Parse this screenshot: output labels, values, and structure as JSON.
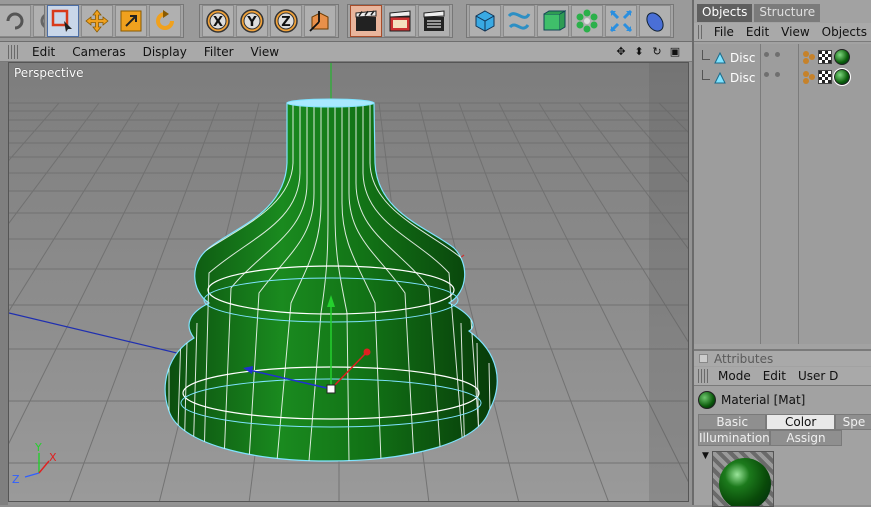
{
  "toolbar": {
    "groups": [
      {
        "buttons": [
          "undo-icon",
          "redo-icon"
        ]
      },
      {
        "buttons": [
          "live-select-icon",
          "move-icon",
          "scale-icon",
          "rotate-icon"
        ]
      },
      {
        "buttons": [
          "x-axis-icon",
          "y-axis-icon",
          "z-axis-icon",
          "coordinate-system-icon"
        ]
      },
      {
        "buttons": [
          "render-view-icon",
          "render-picture-icon",
          "render-settings-icon"
        ]
      },
      {
        "buttons": [
          "cube-icon",
          "spline-pen-icon",
          "nurbs-icon",
          "array-icon",
          "deformer-icon",
          "scene-icon"
        ]
      }
    ],
    "axis_labels": [
      "X",
      "Y",
      "Z"
    ]
  },
  "viewport": {
    "menus": [
      "Edit",
      "Cameras",
      "Display",
      "Filter",
      "View"
    ],
    "nav_icons": [
      "move-view-icon",
      "zoom-view-icon",
      "rotate-view-icon",
      "maximize-view-icon"
    ],
    "camera_label": "Perspective",
    "axis_gizmo": {
      "y": "Y",
      "z": "Z",
      "x": "X"
    }
  },
  "objects_panel": {
    "tabs": [
      "Objects",
      "Structure"
    ],
    "menus": [
      "File",
      "Edit",
      "View",
      "Objects"
    ],
    "items": [
      {
        "name": "Disc"
      },
      {
        "name": "Disc"
      }
    ]
  },
  "attributes_panel": {
    "header": "Attributes",
    "menus": [
      "Mode",
      "Edit",
      "User D"
    ],
    "material_title": "Material [Mat]",
    "tabs_row1": [
      "Basic",
      "Color",
      "Spe"
    ],
    "tabs_row2": [
      "Illumination",
      "Assign"
    ],
    "selected_tab": "Color"
  },
  "colors": {
    "mesh_green": "#0f7a14",
    "wire_white": "#ffffff",
    "selection_cyan": "#7fe3ff",
    "viewport_gray": "#8c8c8c",
    "active_tool_orange": "#e89a2a"
  }
}
